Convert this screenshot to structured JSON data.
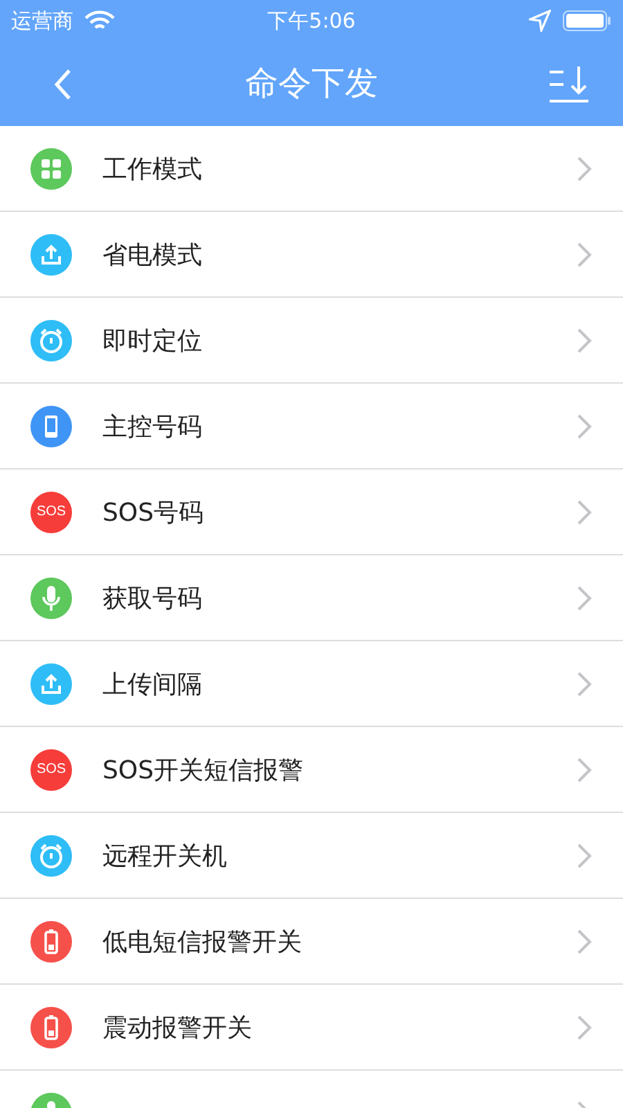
{
  "status_bar": {
    "carrier": "运营商",
    "time": "下午5:06"
  },
  "nav_bar": {
    "title": "命令下发"
  },
  "commands": [
    {
      "label": "工作模式",
      "kind": "grid",
      "color": "#5dc85c"
    },
    {
      "label": "省电模式",
      "kind": "upload",
      "color": "#2ebdf6"
    },
    {
      "label": "即时定位",
      "kind": "alarm",
      "color": "#2ebdf6"
    },
    {
      "label": "主控号码",
      "kind": "phone",
      "color": "#3f95f6"
    },
    {
      "label": "SOS号码",
      "kind": "sos",
      "icon_text": "SOS",
      "color": "#f63d3a"
    },
    {
      "label": "获取号码",
      "kind": "mic",
      "color": "#5dc85c"
    },
    {
      "label": "上传间隔",
      "kind": "upload",
      "color": "#2ebdf6"
    },
    {
      "label": "SOS开关短信报警",
      "kind": "sos",
      "icon_text": "SOS",
      "color": "#f63d3a"
    },
    {
      "label": "远程开关机",
      "kind": "alarm",
      "color": "#2ebdf6"
    },
    {
      "label": "低电短信报警开关",
      "kind": "battery",
      "color": "#f6504a"
    },
    {
      "label": "震动报警开关",
      "kind": "battery",
      "color": "#f6504a"
    },
    {
      "kind": "mic",
      "color": "#5dc85c"
    }
  ]
}
